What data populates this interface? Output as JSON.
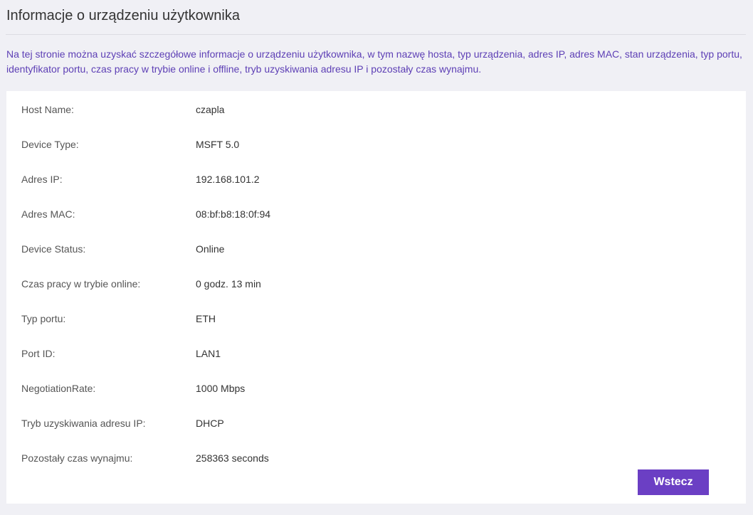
{
  "page": {
    "title": "Informacje o urządzeniu użytkownika",
    "description": "Na tej stronie można uzyskać szczegółowe informacje o urządzeniu użytkownika, w tym nazwę hosta, typ urządzenia, adres IP, adres MAC, stan urządzenia, typ portu, identyfikator portu, czas pracy w trybie online i offline, tryb uzyskiwania adresu IP i pozostały czas wynajmu."
  },
  "device_info": [
    {
      "label": "Host Name:",
      "value": "czapla"
    },
    {
      "label": "Device Type:",
      "value": "MSFT 5.0"
    },
    {
      "label": "Adres IP:",
      "value": "192.168.101.2"
    },
    {
      "label": "Adres MAC:",
      "value": "08:bf:b8:18:0f:94"
    },
    {
      "label": "Device Status:",
      "value": "Online"
    },
    {
      "label": "Czas pracy w trybie online:",
      "value": "0 godz. 13 min"
    },
    {
      "label": "Typ portu:",
      "value": "ETH"
    },
    {
      "label": "Port ID:",
      "value": "LAN1"
    },
    {
      "label": "NegotiationRate:",
      "value": "1000 Mbps"
    },
    {
      "label": "Tryb uzyskiwania adresu IP:",
      "value": "DHCP"
    },
    {
      "label": "Pozostały czas wynajmu:",
      "value": "258363 seconds"
    }
  ],
  "actions": {
    "back_label": "Wstecz"
  },
  "colors": {
    "accent": "#6b3fc4",
    "description_text": "#5d3fb5",
    "background": "#f0f0f5"
  }
}
